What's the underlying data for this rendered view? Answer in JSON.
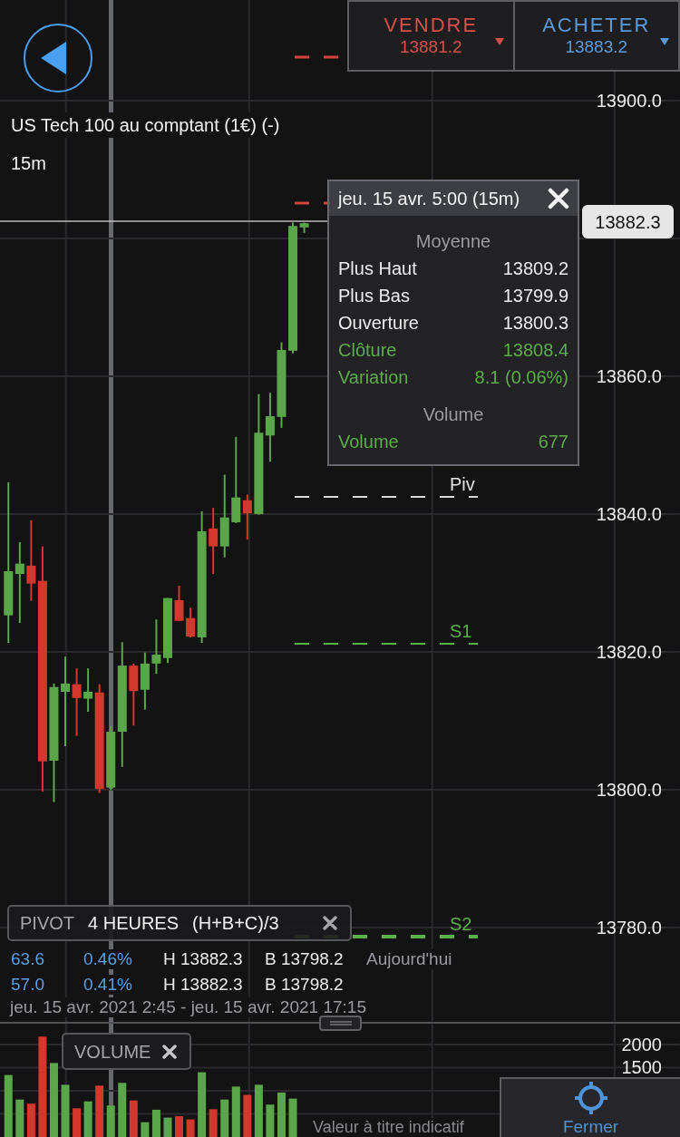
{
  "quotes": [
    {
      "kind": "sell",
      "label": "VENDRE",
      "price": "13881.2"
    },
    {
      "kind": "buy",
      "label": "ACHETER",
      "price": "13883.2"
    }
  ],
  "instrument": {
    "title": "US Tech 100 au comptant (1€) (-)",
    "timeframe": "15m"
  },
  "price_chart": {
    "chart_data": {
      "type": "candlestick",
      "categories": [
        null,
        null,
        null,
        null,
        null,
        null,
        null,
        null,
        null,
        null,
        null,
        null,
        null,
        null,
        null,
        null,
        null,
        null,
        null,
        null,
        null,
        null,
        null,
        null,
        null,
        null,
        null,
        null,
        null,
        null,
        null,
        null,
        null,
        null,
        null,
        null,
        null,
        null,
        null,
        null,
        null,
        null,
        null,
        null,
        null,
        null,
        null,
        null,
        null,
        null,
        null,
        null,
        null,
        null,
        null,
        null,
        null,
        null,
        null
      ],
      "ylim": [
        13766.3,
        13914.6
      ],
      "yticks": [
        {
          "value": 13900,
          "label": "13900.0"
        },
        {
          "value": 13860,
          "label": "13860.0"
        },
        {
          "value": 13840,
          "label": "13840.0"
        },
        {
          "value": 13820,
          "label": "13820.0"
        },
        {
          "value": 13800,
          "label": "13800.0"
        },
        {
          "value": 13780,
          "label": "13780.0"
        }
      ],
      "grid": true,
      "ohlc": [
        [
          13825.3,
          13844.6,
          13821.3,
          13831.7
        ],
        [
          13831.3,
          13835.9,
          13824.2,
          13832.8
        ],
        [
          13832.5,
          13839.1,
          13827.4,
          13829.9
        ],
        [
          13830.3,
          13835.3,
          13799.7,
          13804.1
        ],
        [
          13804.2,
          13815.4,
          13798.2,
          13814.9
        ],
        [
          13814.2,
          13819.3,
          13806.3,
          13815.4
        ],
        [
          13815.3,
          13817.6,
          13807.8,
          13813.3
        ],
        [
          13813.2,
          13817.6,
          13811.3,
          13814.2
        ],
        [
          13814.1,
          13815.3,
          13799.5,
          13800.1
        ],
        [
          13800.3,
          13809.2,
          13799.9,
          13808.4
        ],
        [
          13808.4,
          13821.4,
          13803.3,
          13818.0
        ],
        [
          13818.0,
          13818.3,
          13809.3,
          13814.3
        ],
        [
          13814.5,
          13819.9,
          13811.6,
          13818.3
        ],
        [
          13818.3,
          13824.7,
          13816.8,
          13819.6
        ],
        [
          13819.1,
          13827.8,
          13818.4,
          13827.8
        ],
        [
          13827.5,
          13829.6,
          13824.5,
          13824.5
        ],
        [
          13824.9,
          13826.4,
          13822.1,
          13822.2
        ],
        [
          13822.1,
          13840.4,
          13821.3,
          13837.5
        ],
        [
          13837.9,
          13840.9,
          13831.3,
          13835.3
        ],
        [
          13835.3,
          13845.7,
          13833.7,
          13839.5
        ],
        [
          13838.8,
          13851.2,
          13838.7,
          13842.4
        ],
        [
          13842.0,
          13842.8,
          13836.3,
          13840.1
        ],
        [
          13840.0,
          13857.4,
          13839.9,
          13851.8
        ],
        [
          13851.4,
          13857.6,
          13847.6,
          13854.2
        ],
        [
          13854.1,
          13864.9,
          13852.5,
          13863.8
        ],
        [
          13863.7,
          13882.3,
          13863.3,
          13881.8
        ],
        [
          13881.6,
          13882.3,
          13880.8,
          13882.2
        ],
        null,
        null,
        null,
        null,
        null,
        null,
        null,
        null,
        null,
        null,
        null,
        null,
        null,
        null,
        null,
        null,
        null,
        null,
        null,
        null,
        null,
        null,
        null,
        null,
        null,
        null,
        null,
        null,
        null,
        null,
        null,
        null
      ]
    },
    "crosshair": {
      "price": "13882.3"
    },
    "pivot_lines": [
      {
        "kind": "resistance"
      },
      {
        "kind": "resistance"
      },
      {
        "kind": "pivot",
        "label": "Piv"
      },
      {
        "kind": "support",
        "label": "S1"
      },
      {
        "kind": "support",
        "label": "S2"
      }
    ]
  },
  "tooltip": {
    "title": "jeu. 15 avr. 5:00 (15m)",
    "sections": [
      {
        "heading": "Moyenne",
        "rows": [
          {
            "kind": "neutral",
            "label": "Plus Haut",
            "value": "13809.2"
          },
          {
            "kind": "neutral",
            "label": "Plus Bas",
            "value": "13799.9"
          },
          {
            "kind": "neutral",
            "label": "Ouverture",
            "value": "13800.3"
          },
          {
            "kind": "positive",
            "label": "Clôture",
            "value": "13808.4"
          },
          {
            "kind": "positive",
            "label": "Variation",
            "value": "8.1 (0.06%)"
          }
        ]
      },
      {
        "heading": "Volume",
        "rows": [
          {
            "kind": "positive",
            "label": "Volume",
            "value": "677"
          }
        ]
      }
    ]
  },
  "pivot_legend": {
    "name": "PIVOT",
    "period": "4 HEURES",
    "formula": "(H+B+C)/3",
    "rows": [
      {
        "change": "63.6",
        "percent": "0.46%",
        "high": "H 13882.3",
        "low": "B 13798.2",
        "note": "Aujourd'hui"
      },
      {
        "change": "57.0",
        "percent": "0.41%",
        "high": "H 13882.3",
        "low": "B 13798.2"
      }
    ],
    "range": "jeu. 15 avr. 2021 2:45 - jeu. 15 avr. 2021 17:15"
  },
  "volume_panel": {
    "title": "VOLUME",
    "chart_data": {
      "type": "bar",
      "categories": [
        null,
        null,
        null,
        null,
        null,
        null,
        null,
        null,
        null,
        null,
        null,
        null,
        null,
        null,
        null,
        null,
        null,
        null,
        null,
        null,
        null,
        null,
        null,
        null,
        null,
        null,
        null,
        null,
        null,
        null,
        null,
        null,
        null,
        null,
        null,
        null,
        null,
        null,
        null,
        null,
        null,
        null,
        null,
        null,
        null,
        null,
        null,
        null,
        null,
        null,
        null,
        null,
        null,
        null,
        null,
        null,
        null,
        null,
        null
      ],
      "ylim": [
        0,
        2450
      ],
      "yticks": [
        {
          "value": 2000,
          "label": "2000"
        },
        {
          "value": 1500,
          "label": "1500"
        }
      ],
      "grid": true,
      "stacked": true,
      "series": [
        {
          "color": "#5ba64b",
          "values": [
            1340,
            810,
            null,
            null,
            1600,
            1130,
            null,
            770,
            null,
            680,
            1170,
            null,
            320,
            590,
            420,
            null,
            null,
            1400,
            null,
            810,
            1090,
            null,
            1130,
            700,
            960,
            830,
            null,
            null,
            null,
            null,
            null,
            null,
            null,
            null,
            null,
            null,
            null,
            null,
            null,
            null,
            null,
            null,
            null,
            null,
            null,
            null,
            null,
            null,
            null,
            null,
            null,
            null,
            null,
            null,
            null,
            null,
            null,
            null,
            null
          ]
        },
        {
          "color": "#d2382d",
          "values": [
            null,
            null,
            720,
            2170,
            null,
            null,
            620,
            null,
            1110,
            null,
            null,
            790,
            null,
            null,
            null,
            450,
            380,
            null,
            600,
            null,
            null,
            910,
            null,
            null,
            null,
            null,
            null,
            null,
            null,
            null,
            null,
            null,
            null,
            null,
            null,
            null,
            null,
            null,
            null,
            null,
            null,
            null,
            null,
            null,
            null,
            null,
            null,
            null,
            null,
            null,
            null,
            null,
            null,
            null,
            null,
            null,
            null,
            null,
            null
          ]
        }
      ]
    },
    "disclaimer": "Valeur à titre indicatif"
  },
  "close_button": {
    "label": "Fermer"
  }
}
